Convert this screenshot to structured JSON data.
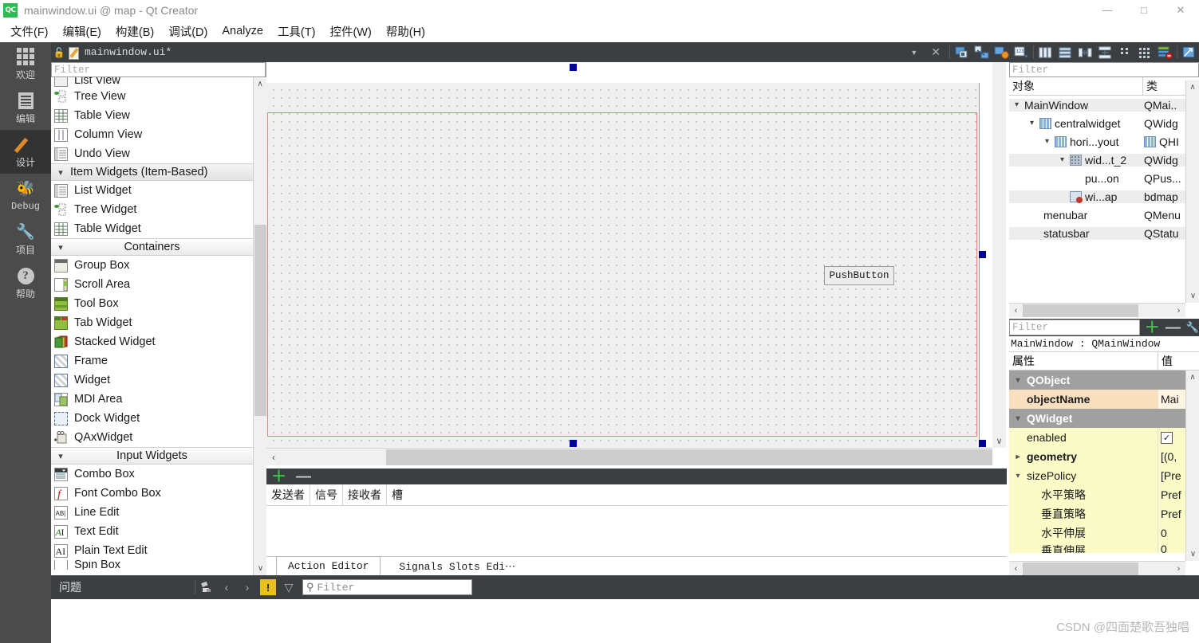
{
  "window": {
    "title": "mainwindow.ui @ map - Qt Creator",
    "logo": "QC",
    "minimize": "—",
    "maximize": "□",
    "close": "✕"
  },
  "menubar": {
    "items": [
      {
        "label": "文件(F)",
        "name": "menu-file"
      },
      {
        "label": "编辑(E)",
        "name": "menu-edit"
      },
      {
        "label": "构建(B)",
        "name": "menu-build"
      },
      {
        "label": "调试(D)",
        "name": "menu-debug"
      },
      {
        "label": "Analyze",
        "name": "menu-analyze"
      },
      {
        "label": "工具(T)",
        "name": "menu-tools"
      },
      {
        "label": "控件(W)",
        "name": "menu-widgets"
      },
      {
        "label": "帮助(H)",
        "name": "menu-help"
      }
    ]
  },
  "modebar": {
    "items": [
      {
        "label": "欢迎",
        "icon": "grid-icon",
        "active": false
      },
      {
        "label": "编辑",
        "icon": "document-icon",
        "active": false
      },
      {
        "label": "设计",
        "icon": "pencil-icon",
        "active": true
      },
      {
        "label": "Debug",
        "icon": "bug-icon",
        "active": false
      },
      {
        "label": "项目",
        "icon": "wrench-icon",
        "active": false
      },
      {
        "label": "帮助",
        "icon": "question-icon",
        "active": false
      }
    ]
  },
  "editor_toolbar": {
    "file_name": "mainwindow.ui*",
    "dropdown_arrow": "▼",
    "close": "✕",
    "lock": "🔓",
    "icons": [
      "edit-widgets-icon",
      "edit-signals-slots-icon",
      "edit-buddies-icon",
      "edit-tab-order-icon",
      "layout-horizontally-icon",
      "layout-vertically-icon",
      "layout-horizontal-splitter-icon",
      "layout-vertical-splitter-icon",
      "layout-form-icon",
      "layout-grid-icon",
      "break-layout-icon",
      "adjust-size-icon"
    ]
  },
  "widget_box": {
    "filter_placeholder": "Filter",
    "rows": [
      {
        "label": "List View",
        "type": "item",
        "icon": "list-view-icon",
        "clip": "top"
      },
      {
        "label": "Tree View",
        "type": "item",
        "icon": "tree-view-icon"
      },
      {
        "label": "Table View",
        "type": "item",
        "icon": "table-view-icon"
      },
      {
        "label": "Column View",
        "type": "item",
        "icon": "column-view-icon"
      },
      {
        "label": "Undo View",
        "type": "item",
        "icon": "undo-view-icon"
      },
      {
        "label": "Item Widgets (Item-Based)",
        "type": "category",
        "align": "left",
        "selected": true
      },
      {
        "label": "List Widget",
        "type": "item",
        "icon": "list-widget-icon"
      },
      {
        "label": "Tree Widget",
        "type": "item",
        "icon": "tree-widget-icon"
      },
      {
        "label": "Table Widget",
        "type": "item",
        "icon": "table-widget-icon"
      },
      {
        "label": "Containers",
        "type": "category"
      },
      {
        "label": "Group Box",
        "type": "item",
        "icon": "group-box-icon"
      },
      {
        "label": "Scroll Area",
        "type": "item",
        "icon": "scroll-area-icon"
      },
      {
        "label": "Tool Box",
        "type": "item",
        "icon": "tool-box-icon"
      },
      {
        "label": "Tab Widget",
        "type": "item",
        "icon": "tab-widget-icon"
      },
      {
        "label": "Stacked Widget",
        "type": "item",
        "icon": "stacked-widget-icon"
      },
      {
        "label": "Frame",
        "type": "item",
        "icon": "frame-icon"
      },
      {
        "label": "Widget",
        "type": "item",
        "icon": "widget-icon"
      },
      {
        "label": "MDI Area",
        "type": "item",
        "icon": "mdi-area-icon"
      },
      {
        "label": "Dock Widget",
        "type": "item",
        "icon": "dock-widget-icon"
      },
      {
        "label": "QAxWidget",
        "type": "item",
        "icon": "qax-widget-icon"
      },
      {
        "label": "Input Widgets",
        "type": "category"
      },
      {
        "label": "Combo Box",
        "type": "item",
        "icon": "combo-box-icon"
      },
      {
        "label": "Font Combo Box",
        "type": "item",
        "icon": "font-combo-box-icon"
      },
      {
        "label": "Line Edit",
        "type": "item",
        "icon": "line-edit-icon"
      },
      {
        "label": "Text Edit",
        "type": "item",
        "icon": "text-edit-icon"
      },
      {
        "label": "Plain Text Edit",
        "type": "item",
        "icon": "plain-text-edit-icon"
      },
      {
        "label": "Spin Box",
        "type": "item",
        "icon": "spin-box-icon",
        "clip": "bottom"
      }
    ],
    "scroll_up": "∧",
    "scroll_down": "∨"
  },
  "canvas": {
    "pushbutton_label": "PushButton",
    "hscroll_left": "‹",
    "hscroll_right": "›",
    "vscroll_down": "∨"
  },
  "bottom_dock": {
    "add": "＋",
    "remove": "—",
    "columns": [
      "发送者",
      "信号",
      "接收者",
      "槽"
    ],
    "tabs": [
      {
        "label": "Action Editor",
        "active": true
      },
      {
        "label": "Signals  Slots Edi⋯",
        "active": false
      }
    ]
  },
  "object_inspector": {
    "filter_placeholder": "Filter",
    "headers": [
      "对象",
      "类"
    ],
    "rows": [
      {
        "name": "MainWindow",
        "class": "QMai..",
        "depth": 0,
        "expander": "⌄",
        "icon": "",
        "alt": true
      },
      {
        "name": "centralwidget",
        "class": "QWidg",
        "depth": 1,
        "expander": "⌄",
        "icon": "hbox",
        "alt": false
      },
      {
        "name": "hori...yout",
        "class": "QHI",
        "depth": 2,
        "expander": "⌄",
        "icon": "hbox",
        "alt": false,
        "class_icon": "hbox"
      },
      {
        "name": "wid...t_2",
        "class": "QWidg",
        "depth": 3,
        "expander": "⌄",
        "icon": "gridw",
        "alt": true
      },
      {
        "name": "pu...on",
        "class": "QPus...",
        "depth": 4,
        "expander": "",
        "icon": "",
        "alt": false
      },
      {
        "name": "wi...ap",
        "class": "bdmap",
        "depth": 4,
        "expander": "",
        "icon": "bmap",
        "alt": true
      },
      {
        "name": "menubar",
        "class": "QMenu",
        "depth": 1,
        "expander": "",
        "icon": "",
        "alt": false
      },
      {
        "name": "statusbar",
        "class": "QStatu",
        "depth": 1,
        "expander": "",
        "icon": "",
        "alt": true
      }
    ],
    "scroll_up": "∧",
    "scroll_down": "∨",
    "hscroll_left": "‹",
    "hscroll_right": "›"
  },
  "property_editor": {
    "filter_placeholder": "Filter",
    "add": "＋",
    "remove": "—",
    "config": "🔧",
    "object_line": "MainWindow : QMainWindow",
    "headers": [
      "属性",
      "值"
    ],
    "rows": [
      {
        "name": "QObject",
        "value": "",
        "style": "grp",
        "chev": "⌄",
        "indent": 0
      },
      {
        "name": "objectName",
        "value": "Mai",
        "style": "o",
        "chev": "",
        "indent": 1
      },
      {
        "name": "QWidget",
        "value": "",
        "style": "grp",
        "chev": "⌄",
        "indent": 0
      },
      {
        "name": "enabled",
        "value": "✓",
        "style": "y",
        "chev": "",
        "indent": 1,
        "control": "checkbox"
      },
      {
        "name": "geometry",
        "value": "[(0, ",
        "style": "y",
        "chev": "›",
        "indent": 0,
        "bold": true
      },
      {
        "name": "sizePolicy",
        "value": "[Pre",
        "style": "y",
        "chev": "⌄",
        "indent": 0
      },
      {
        "name": "水平策略",
        "value": "Pref",
        "style": "y",
        "chev": "",
        "indent": 2
      },
      {
        "name": "垂直策略",
        "value": "Pref",
        "style": "y",
        "chev": "",
        "indent": 2
      },
      {
        "name": "水平伸展",
        "value": "0",
        "style": "y",
        "chev": "",
        "indent": 2
      },
      {
        "name": "垂直伸展",
        "value": "0",
        "style": "y",
        "chev": "",
        "indent": 2
      }
    ],
    "scroll_up": "∧",
    "scroll_down": "∨",
    "hscroll_left": "‹",
    "hscroll_right": "›"
  },
  "statusbar": {
    "label": "问题",
    "clear_icon": "✇",
    "prev": "‹",
    "next": "›",
    "warning": "!",
    "funnel": "▽",
    "search_icon": "⚲",
    "filter_placeholder": "Filter"
  },
  "watermark": "CSDN @四面楚歌吾独唱",
  "colors": {
    "dark_chrome": "#3c3f41",
    "mode_bar": "#4b4b4b",
    "mode_active": "#333333",
    "form_bg": "#f0f0f0",
    "red_border": "#f08080",
    "handle_blue": "#00009e",
    "group_gray": "#a0a0a0",
    "prop_yellow": "#fbfbc8",
    "prop_orange": "#fbe0c0",
    "accent_green": "#3ec24b",
    "warning_yellow": "#e8c020"
  }
}
